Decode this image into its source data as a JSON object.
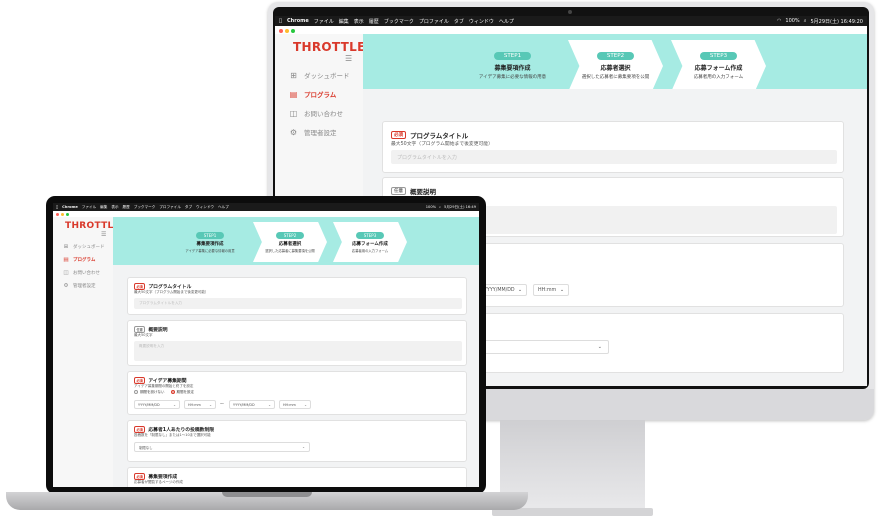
{
  "menubar": {
    "app": "Chrome",
    "items": [
      "ファイル",
      "編集",
      "表示",
      "履歴",
      "ブックマーク",
      "プロファイル",
      "タブ",
      "ウィンドウ",
      "ヘルプ"
    ],
    "clock": "5月29日(土) 16:49:20",
    "clock_small": "5月29日(土) 16:49",
    "battery": "100%"
  },
  "brand": {
    "logo": "THROTTLE",
    "accent": "#d9392b",
    "header_color": "#a6ebe3",
    "step_color": "#58c8b6"
  },
  "sidebar": {
    "items": [
      {
        "label": "ダッシュボード",
        "icon": "grid-icon"
      },
      {
        "label": "プログラム",
        "icon": "calendar-icon"
      },
      {
        "label": "お問い合わせ",
        "icon": "chat-icon"
      },
      {
        "label": "管理者設定",
        "icon": "gear-icon"
      }
    ]
  },
  "steps": [
    {
      "tag": "STEP1",
      "title": "募集要項作成",
      "sub": "アイデア募集に必要な情報の用意"
    },
    {
      "tag": "STEP2",
      "title": "応募者選択",
      "sub": "選択した応募者に募集要項を公開"
    },
    {
      "tag": "STEP3",
      "title": "応募フォーム作成",
      "sub": "応募者用の入力フォーム"
    }
  ],
  "form": {
    "required": "必須",
    "optional": "任意",
    "title_field": {
      "label": "プログラムタイトル",
      "hint": "最大50文字（プログラム開始まで後変更可能）",
      "placeholder": "プログラムタイトルを入力"
    },
    "summary_field": {
      "label": "概要説明",
      "hint": "最大50文字",
      "placeholder": "概要説明を入力"
    },
    "period_field": {
      "label": "アイデア募集期間",
      "hint": "アイデア募集期間の開始と終了を設定",
      "opt_none": "期間を設けない",
      "opt_set": "期間を設定",
      "date_start": "YYYY/MM/DD",
      "time_start": "HH:mm",
      "tilde": "〜",
      "date_end": "YYYY/MM/DD",
      "time_end": "HH:mm"
    },
    "limit_field": {
      "label": "応募者1人あたりの投稿数制限",
      "hint": "投稿数を「制限なし」または1〜10まで選択可能",
      "value": "制限なし"
    },
    "page_field": {
      "label": "募集要項作成",
      "hint": "応募者が閲覧するページの作成"
    }
  }
}
